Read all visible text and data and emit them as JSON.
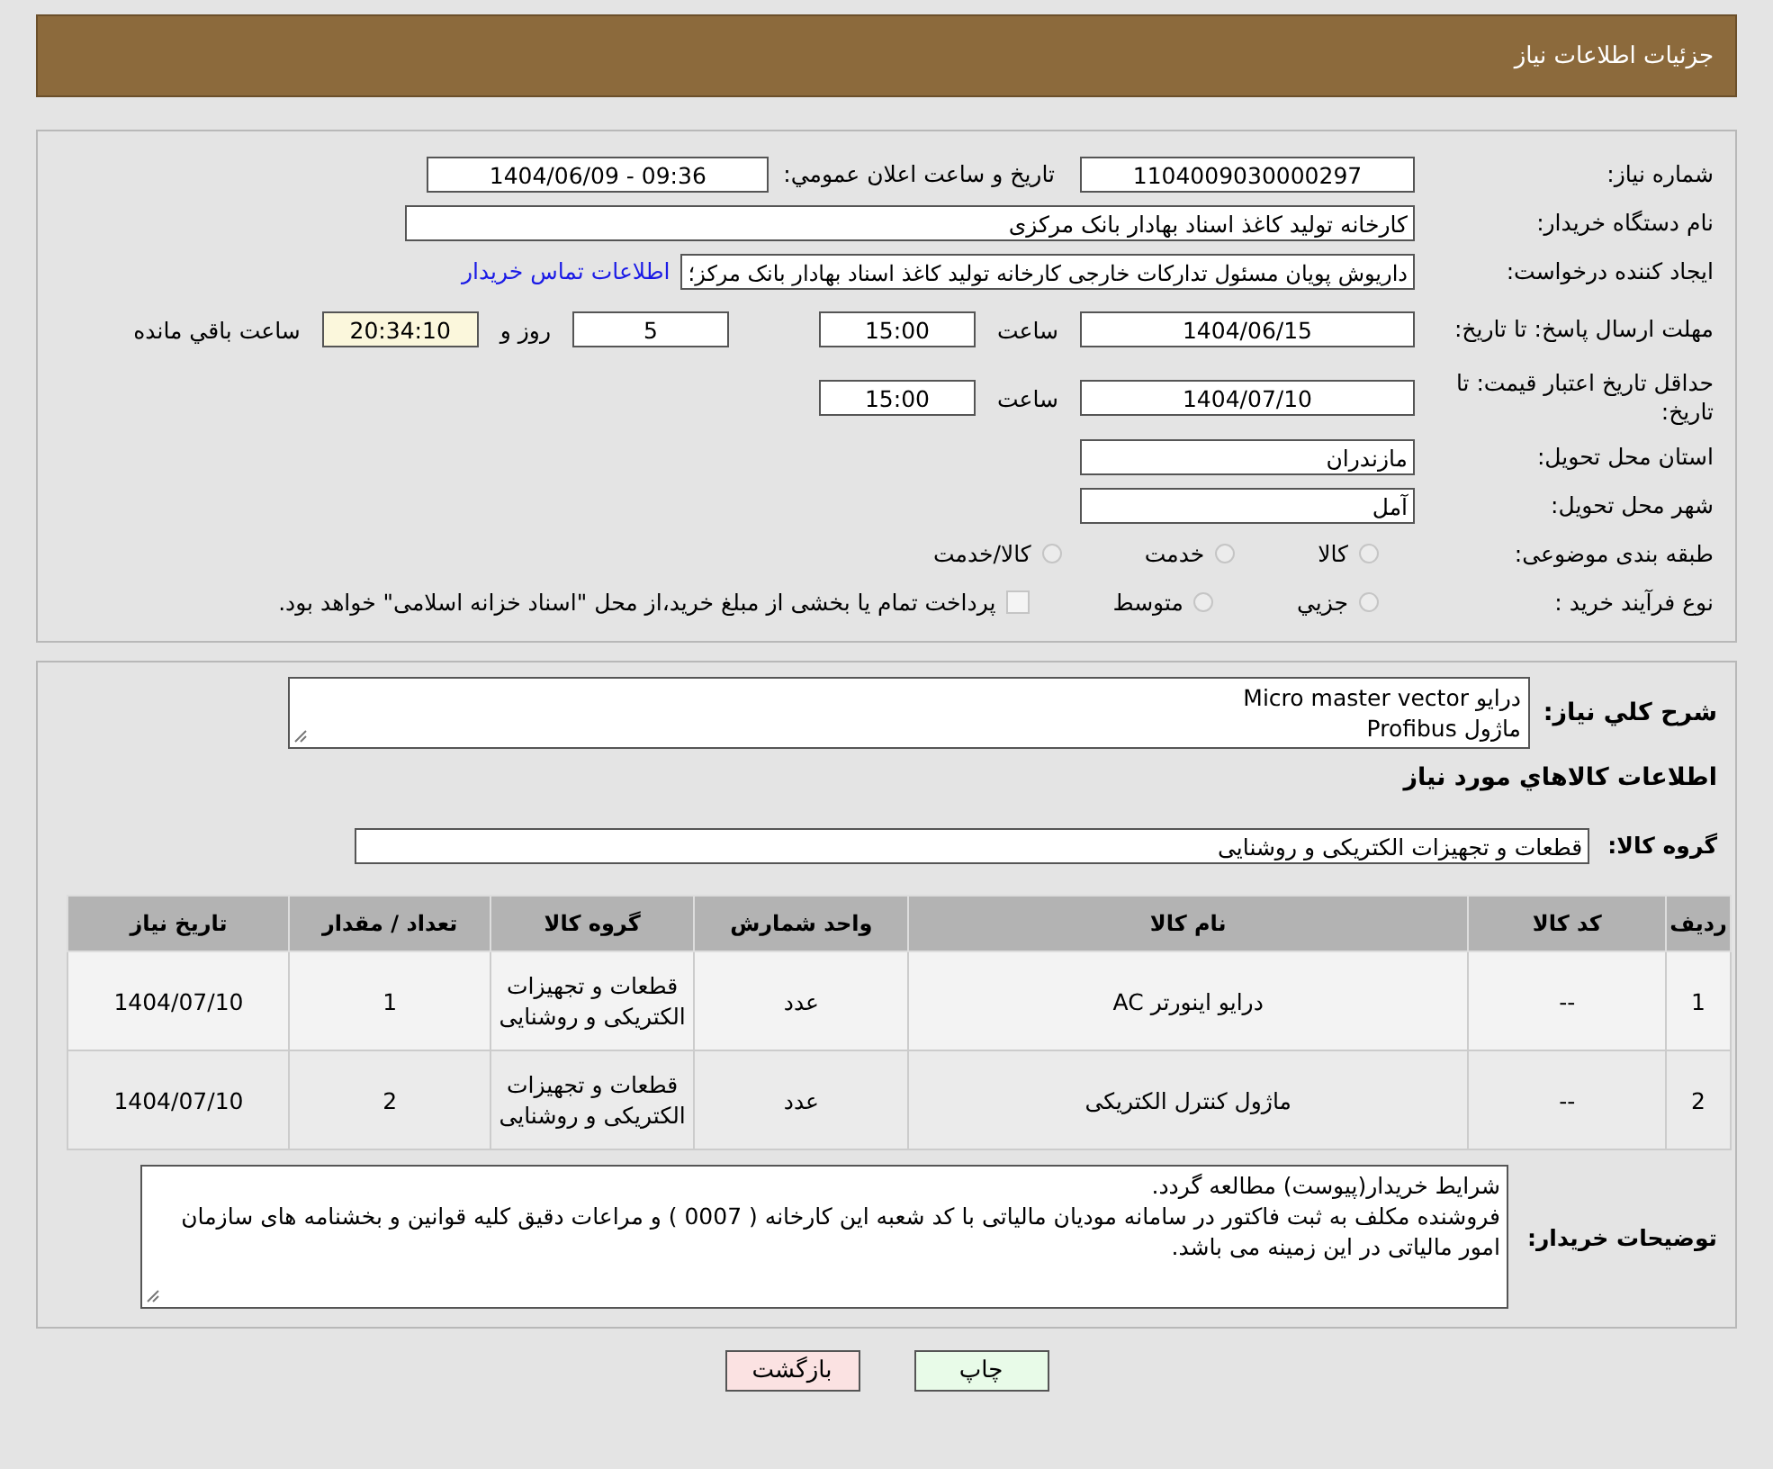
{
  "header": {
    "title": "جزئیات اطلاعات نیاز"
  },
  "need_number": {
    "label": "شماره نیاز:",
    "value": "1104009030000297"
  },
  "announce": {
    "label": "تاریخ و ساعت اعلان عمومي:",
    "value": "1404/06/09 - 09:36"
  },
  "buyer_org": {
    "label": "نام دستگاه خریدار:",
    "value": "کارخانه تولید کاغذ اسناد بهادار بانک مرکزی"
  },
  "requester": {
    "label": "ایجاد کننده درخواست:",
    "value": "داریوش  پویان مسئول تدارکات خارجی کارخانه تولید کاغذ اسناد بهادار بانک مرکز؛",
    "contact_link": "اطلاعات تماس خریدار"
  },
  "reply_deadline": {
    "label": "مهلت ارسال پاسخ: تا تاریخ:",
    "date": "1404/06/15",
    "time_label": "ساعت",
    "time": "15:00",
    "days": "5",
    "days_label": "روز و",
    "remaining": "20:34:10",
    "remaining_label": "ساعت باقي مانده"
  },
  "price_validity": {
    "label": "حداقل تاریخ اعتبار قیمت: تا تاریخ:",
    "date": "1404/07/10",
    "time_label": "ساعت",
    "time": "15:00"
  },
  "province": {
    "label": "استان محل تحویل:",
    "value": "مازندران"
  },
  "city": {
    "label": "شهر محل تحویل:",
    "value": "آمل"
  },
  "category": {
    "label": "طبقه بندی موضوعی:",
    "options": [
      {
        "label": "کالا",
        "selected": false
      },
      {
        "label": "خدمت",
        "selected": false
      },
      {
        "label": "کالا/خدمت",
        "selected": false
      }
    ]
  },
  "process": {
    "label": "نوع فرآیند خرید :",
    "options": [
      {
        "label": "جزيي",
        "selected": false
      },
      {
        "label": "متوسط",
        "selected": false
      }
    ],
    "payment": {
      "checked": false,
      "text": "پرداخت تمام یا بخشی از مبلغ خرید،از محل \"اسناد خزانه اسلامی\" خواهد بود."
    }
  },
  "description": {
    "label": "شرح كلي نياز:",
    "lines": [
      "درایو Micro master vector",
      "ماژول Profibus"
    ]
  },
  "goods_heading": "اطلاعات كالاهاي مورد نياز",
  "goods_group": {
    "label": "گروه کالا:",
    "value": "قطعات و تجهیزات الکتریکی و روشنایی"
  },
  "table": {
    "columns": [
      "ردیف",
      "کد کالا",
      "نام کالا",
      "واحد شمارش",
      "گروه کالا",
      "تعداد / مقدار",
      "تاریخ نیاز"
    ],
    "rows": [
      [
        "1",
        "--",
        "درایو اینورتر AC",
        "عدد",
        "قطعات و تجهیزات الکتریکی و روشنایی",
        "1",
        "1404/07/10"
      ],
      [
        "2",
        "--",
        "ماژول کنترل الکتریکی",
        "عدد",
        "قطعات و تجهیزات الکتریکی و روشنایی",
        "2",
        "1404/07/10"
      ]
    ]
  },
  "buyer_notes": {
    "label": "توضیحات خریدار:",
    "lines": [
      "شرایط  خریدار(پیوست) مطالعه گردد.",
      "  فروشنده مکلف به ثبت فاکتور در سامانه مودیان مالیاتی با کد شعبه این کارخانه ( 0007 ) و مراعات دقیق کلیه قوانین و بخشنامه های سازمان امور مالیاتی در این زمینه می باشد."
    ]
  },
  "buttons": [
    {
      "label": "چاپ",
      "kind": "print"
    },
    {
      "label": "بازگشت",
      "kind": "back"
    }
  ]
}
